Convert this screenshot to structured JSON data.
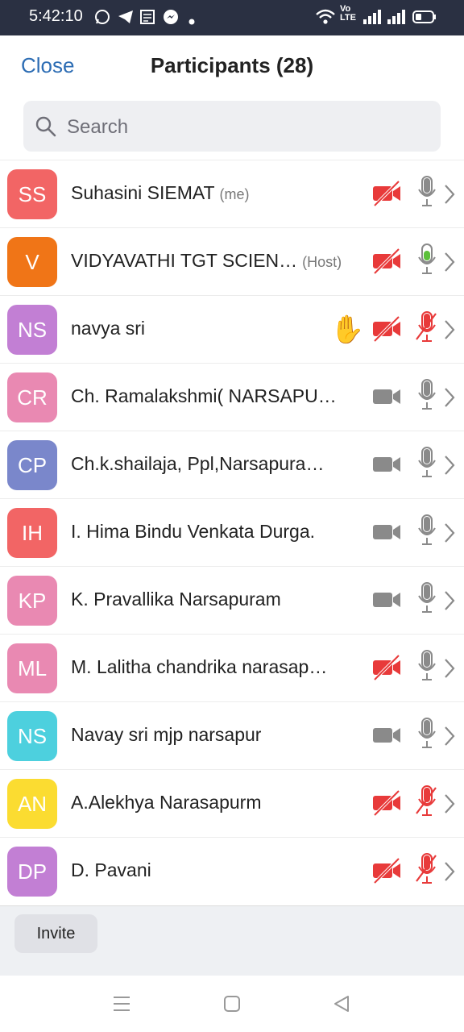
{
  "status_bar": {
    "time": "5:42:10",
    "notif_icons": [
      "whatsapp-icon",
      "telegram-icon",
      "news-icon",
      "messenger-icon",
      "dot-icon"
    ],
    "right_icons": [
      "wifi-icon",
      "volte-icon",
      "signal-icon",
      "signal-icon",
      "battery-icon"
    ],
    "volte_label": "Vo\nLTE"
  },
  "header": {
    "close_label": "Close",
    "title": "Participants (28)"
  },
  "search": {
    "placeholder": "Search"
  },
  "participants": [
    {
      "initials": "SS",
      "name": "Suhasini SIEMAT",
      "tag": "(me)",
      "color": "#f26565",
      "video": "off",
      "mic": "on-grey",
      "hand": false
    },
    {
      "initials": "V",
      "name": "VIDYAVATHI TGT  SCIEN…",
      "tag": "(Host)",
      "color": "#f07517",
      "video": "off",
      "mic": "active-green",
      "hand": false
    },
    {
      "initials": "NS",
      "name": "navya sri",
      "tag": "",
      "color": "#c27fd4",
      "video": "off",
      "mic": "muted",
      "hand": true
    },
    {
      "initials": "CR",
      "name": "Ch. Ramalakshmi( NARSAPU…",
      "tag": "",
      "color": "#e989b2",
      "video": "on",
      "mic": "on-grey",
      "hand": false
    },
    {
      "initials": "CP",
      "name": "Ch.k.shailaja, Ppl,Narsapura…",
      "tag": "",
      "color": "#7a87cb",
      "video": "on",
      "mic": "on-grey",
      "hand": false
    },
    {
      "initials": "IH",
      "name": "I. Hima Bindu Venkata Durga.",
      "tag": "",
      "color": "#f26565",
      "video": "on",
      "mic": "on-grey",
      "hand": false
    },
    {
      "initials": "KP",
      "name": "K. Pravallika Narsapuram",
      "tag": "",
      "color": "#e989b2",
      "video": "on",
      "mic": "on-grey",
      "hand": false
    },
    {
      "initials": "ML",
      "name": "M. Lalitha chandrika narasap…",
      "tag": "",
      "color": "#e989b2",
      "video": "off",
      "mic": "on-grey",
      "hand": false
    },
    {
      "initials": "NS",
      "name": "Navay sri  mjp narsapur",
      "tag": "",
      "color": "#4dd0de",
      "video": "on",
      "mic": "on-grey",
      "hand": false
    },
    {
      "initials": "AN",
      "name": "A.Alekhya Narasapurm",
      "tag": "",
      "color": "#fbdc31",
      "video": "off",
      "mic": "muted",
      "hand": false
    },
    {
      "initials": "DP",
      "name": "D. Pavani",
      "tag": "",
      "color": "#c27fd4",
      "video": "off",
      "mic": "muted",
      "hand": false
    }
  ],
  "footer": {
    "invite_label": "Invite"
  },
  "nav_icons": [
    "menu-icon",
    "home-square-icon",
    "back-triangle-icon"
  ],
  "colors": {
    "accent": "#2d6db4",
    "muted_red": "#e83a3a",
    "green": "#5cc03b",
    "grey_icon": "#8a8a8a"
  }
}
